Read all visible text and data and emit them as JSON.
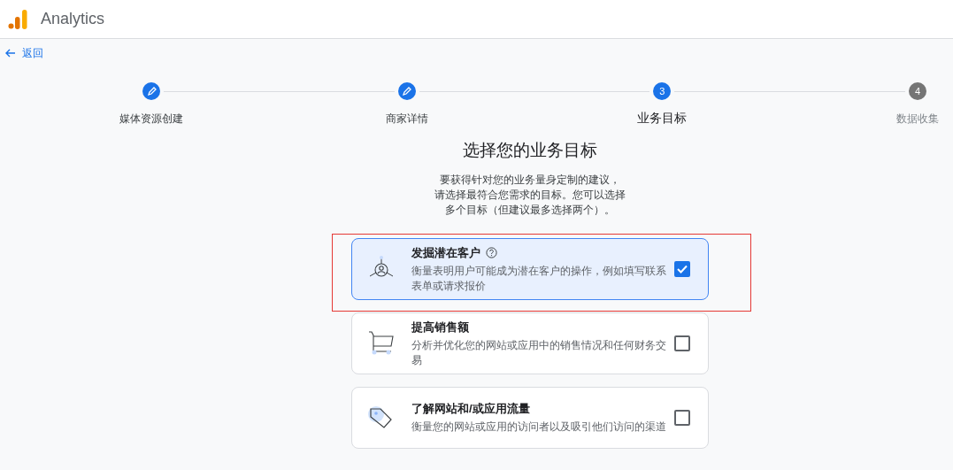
{
  "app": {
    "name": "Analytics"
  },
  "back_link": {
    "label": "返回"
  },
  "steps": [
    {
      "label": "媒体资源创建",
      "kind": "completed"
    },
    {
      "label": "商家详情",
      "kind": "completed"
    },
    {
      "label": "业务目标",
      "kind": "current",
      "number": "3"
    },
    {
      "label": "数据收集",
      "kind": "pending",
      "number": "4"
    }
  ],
  "heading": "选择您的业务目标",
  "intro": [
    "要获得针对您的业务量身定制的建议，",
    "请选择最符合您需求的目标。您可以选择",
    "多个目标（但建议最多选择两个）。"
  ],
  "goals": [
    {
      "kind": "leads",
      "title": "发掘潜在客户",
      "help": true,
      "description": "衡量表明用户可能成为潜在客户的操作，例如填写联系表单或请求报价",
      "checked": true,
      "highlighted": true
    },
    {
      "kind": "sales",
      "title": "提高销售额",
      "help": false,
      "description": "分析并优化您的网站或应用中的销售情况和任何财务交易",
      "checked": false,
      "highlighted": false
    },
    {
      "kind": "traffic",
      "title": "了解网站和/或应用流量",
      "help": false,
      "description": "衡量您的网站或应用的访问者以及吸引他们访问的渠道",
      "checked": false,
      "highlighted": false
    }
  ]
}
